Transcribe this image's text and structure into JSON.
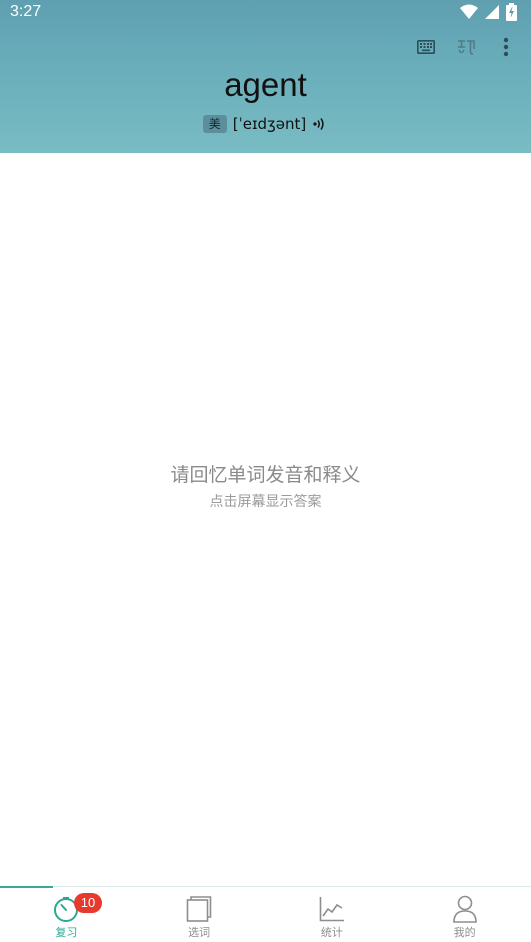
{
  "status_bar": {
    "time": "3:27",
    "icons": [
      "wifi-icon",
      "signal-icon",
      "battery-icon"
    ]
  },
  "toolbar": {
    "icons": [
      "keyboard-icon",
      "spell-icon",
      "more-vert-icon"
    ]
  },
  "card": {
    "word": "agent",
    "region": "美",
    "phonetic": "[ˈeɪdʒənt]",
    "speaker_icon": "speaker-icon"
  },
  "prompt": {
    "title": "请回忆单词发音和释义",
    "subtitle": "点击屏幕显示答案"
  },
  "nav": {
    "items": [
      {
        "label": "复习",
        "icon": "timer-icon",
        "active": true,
        "badge": "10"
      },
      {
        "label": "选词",
        "icon": "book-icon",
        "active": false
      },
      {
        "label": "统计",
        "icon": "chart-icon",
        "active": false
      },
      {
        "label": "我的",
        "icon": "person-icon",
        "active": false
      }
    ]
  },
  "colors": {
    "header_top": "#5f9fb0",
    "header_bottom": "#79bcc4",
    "accent": "#2aa890",
    "badge": "#e8392f"
  }
}
